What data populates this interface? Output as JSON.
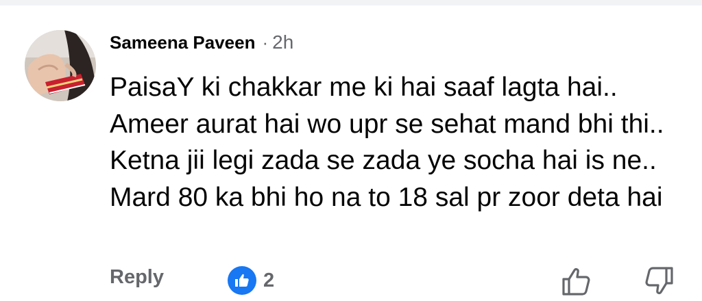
{
  "comment": {
    "author": "Sameena Paveen",
    "separator": "·",
    "time": "2h",
    "text": "PaisaY ki chakkar me ki hai saaf lagta hai.. Ameer aurat hai wo upr se sehat mand bhi thi.. Ketna jii legi zada se zada ye socha hai is ne.. Mard 80 ka bhi ho na to 18 sal pr zoor deta hai",
    "reply_label": "Reply",
    "reaction_count": "2"
  },
  "icons": {
    "reaction": "like-icon",
    "upvote": "thumbs-up-outline-icon",
    "downvote": "thumbs-down-outline-icon"
  },
  "colors": {
    "accent": "#1877f2",
    "text_primary": "#050505",
    "text_secondary": "#65676b"
  }
}
